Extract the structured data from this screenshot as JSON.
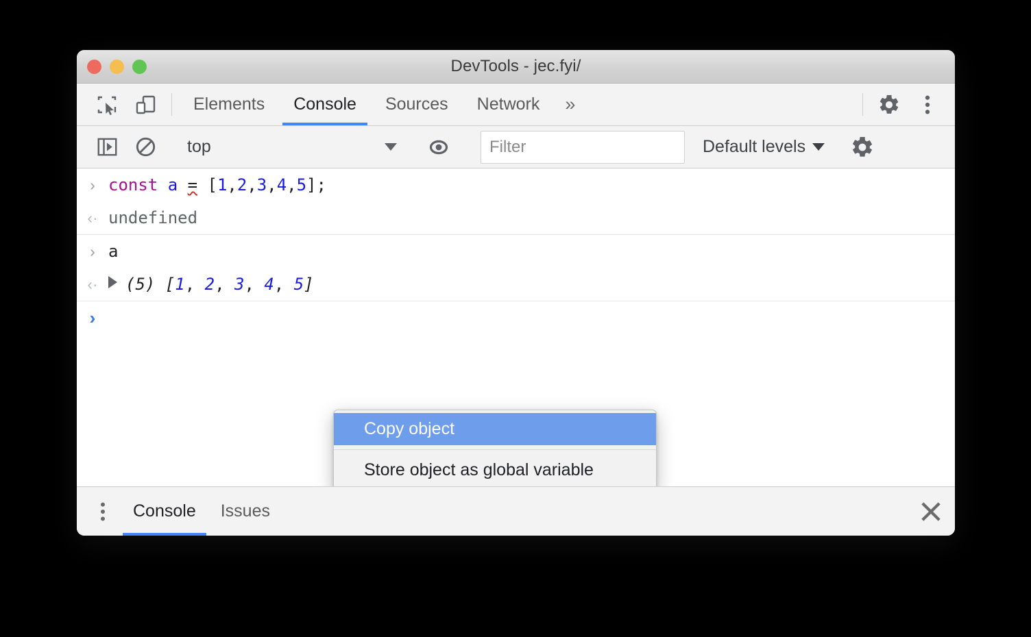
{
  "window": {
    "title": "DevTools - jec.fyi/",
    "traffic_lights": [
      {
        "name": "close",
        "color": "#ed6a5e"
      },
      {
        "name": "minimize",
        "color": "#f4bf50"
      },
      {
        "name": "zoom",
        "color": "#61c554"
      }
    ]
  },
  "main_toolbar": {
    "inspect_icon": "inspect-element-icon",
    "device_icon": "device-toolbar-icon",
    "tabs": [
      {
        "label": "Elements",
        "active": false
      },
      {
        "label": "Console",
        "active": true
      },
      {
        "label": "Sources",
        "active": false
      },
      {
        "label": "Network",
        "active": false
      }
    ],
    "more_tabs_label": "»",
    "settings_icon": "gear-icon",
    "more_options_icon": "kebab-menu-icon"
  },
  "console_toolbar": {
    "sidebar_toggle_icon": "console-sidebar-icon",
    "clear_console_icon": "clear-console-icon",
    "context": {
      "value": "top",
      "caret": "chevron-down-icon"
    },
    "live_expression_icon": "eye-icon",
    "filter": {
      "value": "",
      "placeholder": "Filter"
    },
    "levels": {
      "label": "Default levels",
      "caret": "chevron-down-icon"
    },
    "settings_icon": "gear-icon"
  },
  "console": {
    "rows": [
      {
        "type": "input",
        "marker": "›",
        "text": "const a = [1,2,3,4,5];",
        "tokens": [
          {
            "text": "const",
            "kind": "keyword"
          },
          {
            "text": " ",
            "kind": "plain"
          },
          {
            "text": "a",
            "kind": "variable"
          },
          {
            "text": " ",
            "kind": "plain"
          },
          {
            "text": "=",
            "kind": "operator-error"
          },
          {
            "text": " ",
            "kind": "plain"
          },
          {
            "text": "[",
            "kind": "punct"
          },
          {
            "text": "1",
            "kind": "number"
          },
          {
            "text": ",",
            "kind": "punct"
          },
          {
            "text": "2",
            "kind": "number"
          },
          {
            "text": ",",
            "kind": "punct"
          },
          {
            "text": "3",
            "kind": "number"
          },
          {
            "text": ",",
            "kind": "punct"
          },
          {
            "text": "4",
            "kind": "number"
          },
          {
            "text": ",",
            "kind": "punct"
          },
          {
            "text": "5",
            "kind": "number"
          },
          {
            "text": "];",
            "kind": "punct"
          }
        ]
      },
      {
        "type": "output",
        "marker": "‹·",
        "text": "undefined"
      },
      {
        "type": "input",
        "marker": "›",
        "text": "a"
      },
      {
        "type": "output-object",
        "marker": "‹·",
        "expander": "expand-triangle-icon",
        "length_label": "(5)",
        "open_bracket": "[",
        "items": [
          "1",
          "2",
          "3",
          "4",
          "5"
        ],
        "separator": ", ",
        "close_bracket": "]"
      },
      {
        "type": "prompt",
        "marker": "›",
        "text": ""
      }
    ]
  },
  "context_menu": {
    "items": [
      {
        "label": "Copy object",
        "selected": true
      },
      {
        "label": "Store object as global variable",
        "selected": false
      }
    ]
  },
  "drawer": {
    "menu_icon": "kebab-menu-icon",
    "tabs": [
      {
        "label": "Console",
        "active": true
      },
      {
        "label": "Issues",
        "active": false
      }
    ],
    "close_icon": "close-icon"
  },
  "colors": {
    "accent": "#4285f4",
    "menu_highlight": "#6e9eeb",
    "keyword": "#aa0d91",
    "number": "#1a1ae6",
    "error_squiggle": "#c43b32",
    "toolbar_bg": "#f3f3f3",
    "titlebar_bg": "#d3d3d3"
  }
}
